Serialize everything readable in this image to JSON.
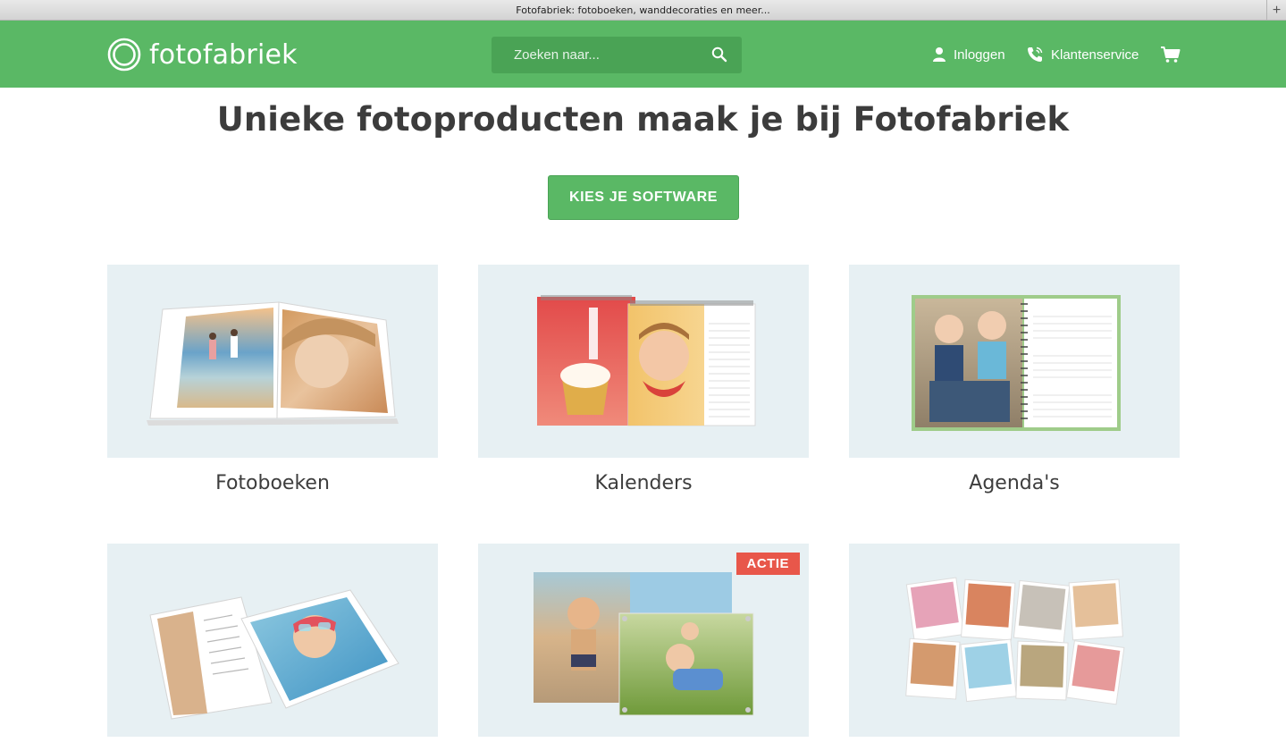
{
  "window": {
    "title": "Fotofabriek: fotoboeken, wanddecoraties en meer...",
    "new_tab": "+"
  },
  "header": {
    "brand": "fotofabriek",
    "search_placeholder": "Zoeken naar...",
    "login": "Inloggen",
    "service": "Klantenservice",
    "icons": [
      "logo-ring-icon",
      "search-icon",
      "user-icon",
      "phone-icon",
      "cart-icon"
    ]
  },
  "main": {
    "headline": "Unieke fotoproducten maak je bij Fotofabriek",
    "cta": "KIES JE SOFTWARE",
    "products": [
      {
        "label": "Fotoboeken"
      },
      {
        "label": "Kalenders"
      },
      {
        "label": "Agenda's"
      },
      {
        "label": ""
      },
      {
        "label": "",
        "badge": "ACTIE"
      },
      {
        "label": ""
      }
    ]
  },
  "colors": {
    "brand_green": "#5ab865",
    "search_bg": "#4aa355",
    "tile_bg": "#e7f0f3",
    "badge_red": "#e8574a"
  }
}
